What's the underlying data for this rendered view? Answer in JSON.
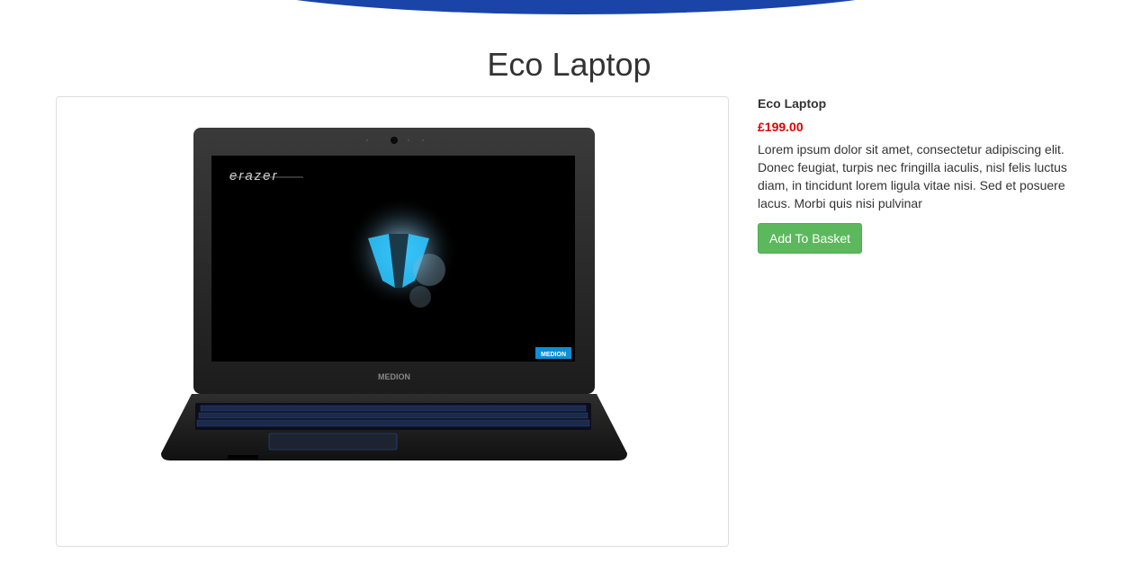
{
  "page": {
    "title": "Eco Laptop"
  },
  "product": {
    "name": "Eco Laptop",
    "price": "£199.00",
    "description": "Lorem ipsum dolor sit amet, consectetur adipiscing elit. Donec feugiat, turpis nec fringilla iaculis, nisl felis luctus diam, in tincidunt lorem ligula vitae nisi. Sed et posuere lacus. Morbi quis nisi pulvinar",
    "add_button_label": "Add To Basket",
    "image": {
      "screen_text": "erazer",
      "badge_text": "MEDION",
      "bezel_logo": "MEDION"
    }
  },
  "colors": {
    "header": "#1a44a8",
    "price": "#e00000",
    "button": "#5cb85c"
  }
}
